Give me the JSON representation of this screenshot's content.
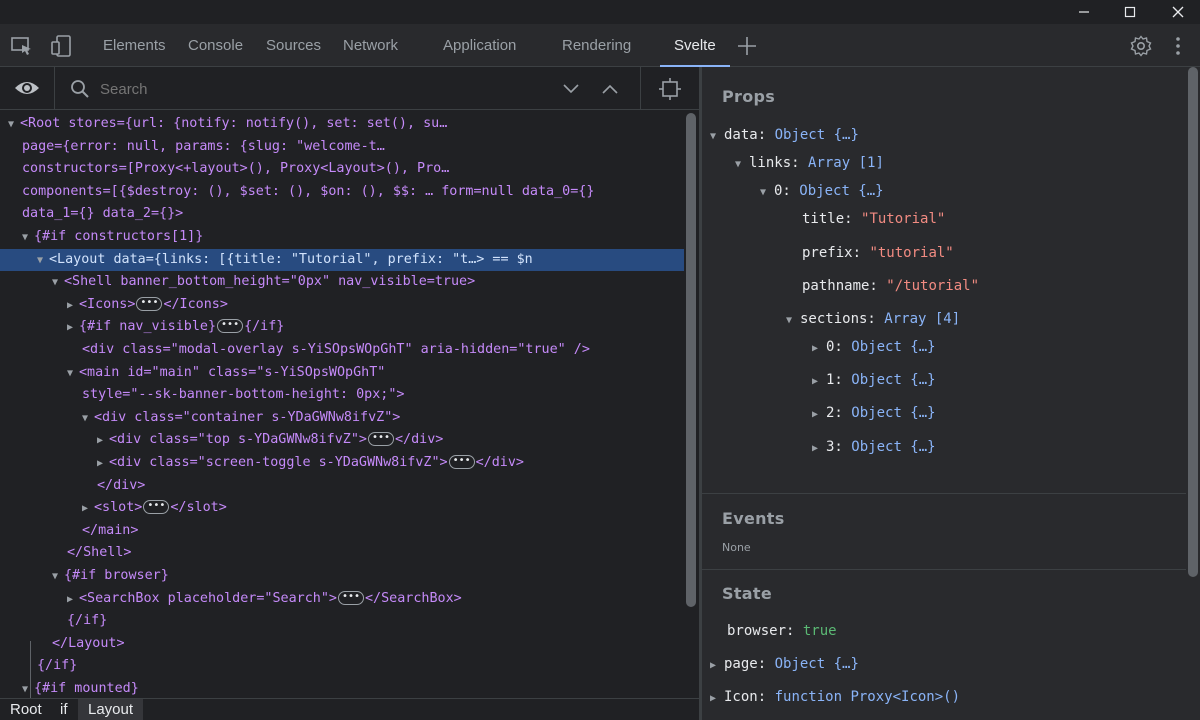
{
  "window": {
    "minimize_icon": "minimize-icon",
    "maximize_icon": "maximize-icon",
    "close_icon": "close-icon"
  },
  "tabs": [
    {
      "label": "Elements"
    },
    {
      "label": "Console"
    },
    {
      "label": "Sources"
    },
    {
      "label": "Network"
    },
    {
      "label": "Application"
    },
    {
      "label": "Rendering"
    },
    {
      "label": "Svelte",
      "active": true
    }
  ],
  "left_toolbar": {
    "search_placeholder": "Search"
  },
  "tree": {
    "l1a": "<Root stores={url: {notify: notify(), set: set(), su…",
    "l1b": "page={error: null, params: {slug: \"welcome-t…",
    "l1c": "constructors=[Proxy<+layout>(), Proxy<Layout>(), Pro…",
    "l1d": "components=[{$destroy: (), $set: (), $on: (), $$: … form=null data_0={}",
    "l1e": "data_1={} data_2={}>",
    "l2": "{#if constructors[1]}",
    "l3": "<Layout data={links: [{title: \"Tutorial\", prefix: \"t…> == $n",
    "l4": "<Shell banner_bottom_height=\"0px\" nav_visible=true>",
    "l5a": "<Icons>",
    "l5b": "</Icons>",
    "l6a": "{#if nav_visible}",
    "l6b": "{/if}",
    "l7": "<div class=\"modal-overlay s-YiSOpsWOpGhT\" aria-hidden=\"true\" />",
    "l8a": "<main id=\"main\" class=\"s-YiSOpsWOpGhT\"",
    "l8b": "style=\"--sk-banner-bottom-height: 0px;\">",
    "l9": "<div class=\"container s-YDaGWNw8ifvZ\">",
    "l10a": "<div class=\"top s-YDaGWNw8ifvZ\">",
    "l10b": "</div>",
    "l11a": "<div class=\"screen-toggle s-YDaGWNw8ifvZ\">",
    "l11b": "</div>",
    "l12": "</div>",
    "l13a": "<slot>",
    "l13b": "</slot>",
    "l14": "</main>",
    "l15": "</Shell>",
    "l16": "{#if browser}",
    "l17a": "<SearchBox placeholder=\"Search\">",
    "l17b": "</SearchBox>",
    "l18": "{/if}",
    "l19": "</Layout>",
    "l20": "{/if}",
    "l21": "{#if mounted}"
  },
  "breadcrumbs": [
    {
      "label": "Root"
    },
    {
      "label": "if"
    },
    {
      "label": "Layout"
    }
  ],
  "props": {
    "title": "Props",
    "data_k": "data:",
    "data_v": "Object {…}",
    "links_k": "links:",
    "links_v": "Array [1]",
    "zero_k": "0:",
    "zero_v": "Object {…}",
    "title_k": "title:",
    "title_v": "\"Tutorial\"",
    "prefix_k": "prefix:",
    "prefix_v": "\"tutorial\"",
    "pathname_k": "pathname:",
    "pathname_v": "\"/tutorial\"",
    "sections_k": "sections:",
    "sections_v": "Array [4]",
    "s0_k": "0:",
    "s0_v": "Object {…}",
    "s1_k": "1:",
    "s1_v": "Object {…}",
    "s2_k": "2:",
    "s2_v": "Object {…}",
    "s3_k": "3:",
    "s3_v": "Object {…}"
  },
  "events": {
    "title": "Events",
    "empty": "None"
  },
  "state": {
    "title": "State",
    "browser_k": "browser:",
    "browser_v": "true",
    "page_k": "page:",
    "page_v": "Object {…}",
    "icon_k": "Icon:",
    "icon_v": "function Proxy<Icon>()"
  },
  "colors": {
    "accent": "#8ab4f8",
    "selection": "#284b80",
    "markup": "#c58af9",
    "string": "#f28b82",
    "boolean": "#5bb974"
  }
}
